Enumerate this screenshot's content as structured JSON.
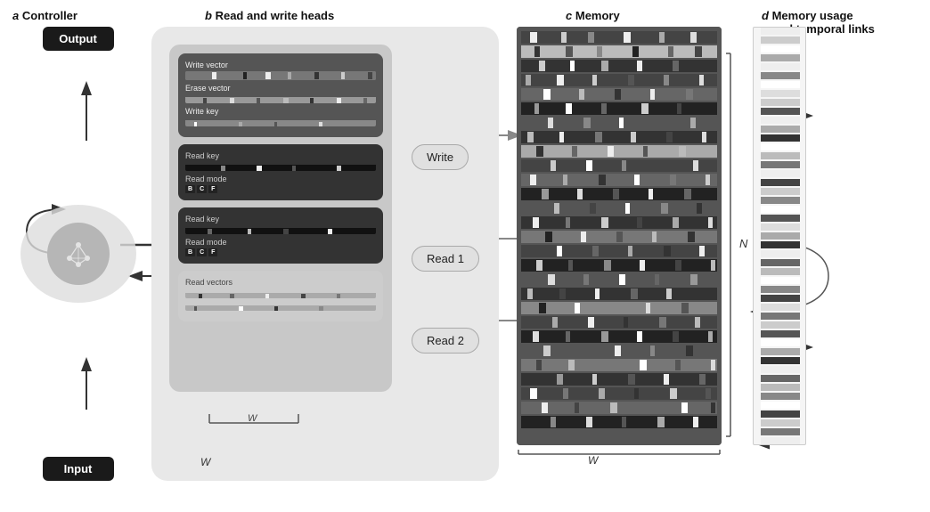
{
  "sections": {
    "a": {
      "letter": "a",
      "title": "Controller"
    },
    "b": {
      "letter": "b",
      "title": "Read and write heads"
    },
    "c": {
      "letter": "c",
      "title": "Memory"
    },
    "d": {
      "letter": "d",
      "title": "Memory usage",
      "subtitle": "and temporal links"
    }
  },
  "controller": {
    "output_label": "Output",
    "input_label": "Input"
  },
  "write_head": {
    "write_vector_label": "Write vector",
    "erase_vector_label": "Erase vector",
    "write_key_label": "Write key"
  },
  "read_heads": [
    {
      "key_label": "Read key",
      "mode_label": "Read mode",
      "bcf": [
        "B",
        "C",
        "F"
      ],
      "btn": "Read 1"
    },
    {
      "key_label": "Read key",
      "mode_label": "Read mode",
      "bcf": [
        "B",
        "C",
        "F"
      ],
      "btn": "Read 2"
    }
  ],
  "read_vectors_label": "Read vectors",
  "write_btn": "Write",
  "W_label": "W",
  "N_label": "N"
}
